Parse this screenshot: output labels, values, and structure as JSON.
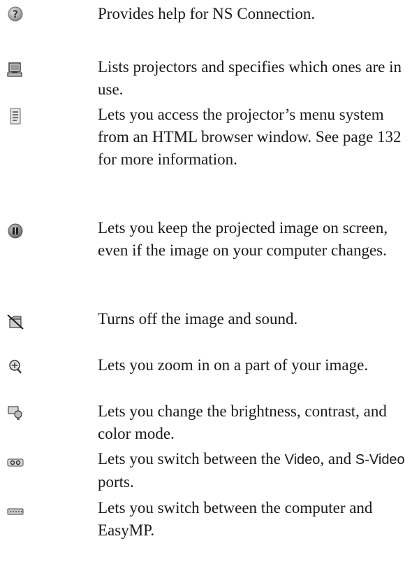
{
  "rows": [
    {
      "icon": "help-icon",
      "text": "Provides help for NS Connection."
    },
    {
      "icon": "projector-list-icon",
      "text": "Lists projectors and specifies which ones are in use."
    },
    {
      "icon": "web-menu-icon",
      "text": "Lets you access the projector’s menu system from an HTML browser window. See page 132 for more information."
    },
    {
      "icon": "pause-icon",
      "text": "Lets you keep the projected image on screen, even if the image on your computer changes."
    },
    {
      "icon": "av-mute-icon",
      "text": "Turns off the image and sound."
    },
    {
      "icon": "zoom-icon",
      "text": "Lets you zoom in on a part of your image."
    },
    {
      "icon": "image-adjust-icon",
      "text": "Lets you change the brightness, contrast, and color mode."
    },
    {
      "icon": "video-source-icon",
      "text_before": "Lets you switch between the ",
      "video": "Video",
      "text_mid": ", and ",
      "svideo": "S-Video",
      "text_after": " ports."
    },
    {
      "icon": "computer-source-icon",
      "text": "Lets you switch between the computer and EasyMP."
    }
  ]
}
